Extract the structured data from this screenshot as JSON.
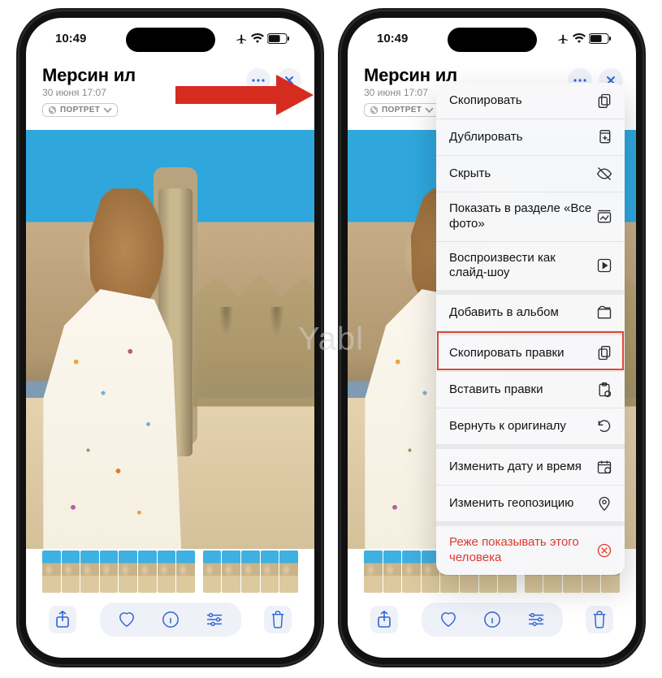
{
  "status": {
    "time": "10:49",
    "battery": "62"
  },
  "header": {
    "title": "Мерсин ил",
    "subtitle": "30 июня 17:07"
  },
  "badge": {
    "label": "ПОРТРЕТ"
  },
  "thumbnail_count": 13,
  "menu": {
    "items": [
      {
        "label": "Скопировать",
        "icon": "copy"
      },
      {
        "label": "Дублировать",
        "icon": "duplicate"
      },
      {
        "label": "Скрыть",
        "icon": "hide"
      },
      {
        "label": "Показать в разделе «Все фото»",
        "icon": "gallery"
      },
      {
        "label": "Воспроизвести как слайд-шоу",
        "icon": "play"
      },
      {
        "label": "Добавить в альбом",
        "icon": "album",
        "sep": true
      },
      {
        "label": "Скопировать правки",
        "icon": "copyedits",
        "sep": true,
        "highlight": true
      },
      {
        "label": "Вставить правки",
        "icon": "pasteedits"
      },
      {
        "label": "Вернуть к оригиналу",
        "icon": "revert"
      },
      {
        "label": "Изменить дату и время",
        "icon": "calendar",
        "sep": true
      },
      {
        "label": "Изменить геопозицию",
        "icon": "location"
      },
      {
        "label": "Реже показывать этого человека",
        "icon": "block",
        "sep": true,
        "destructive": true
      }
    ]
  },
  "watermark": "Yabl"
}
